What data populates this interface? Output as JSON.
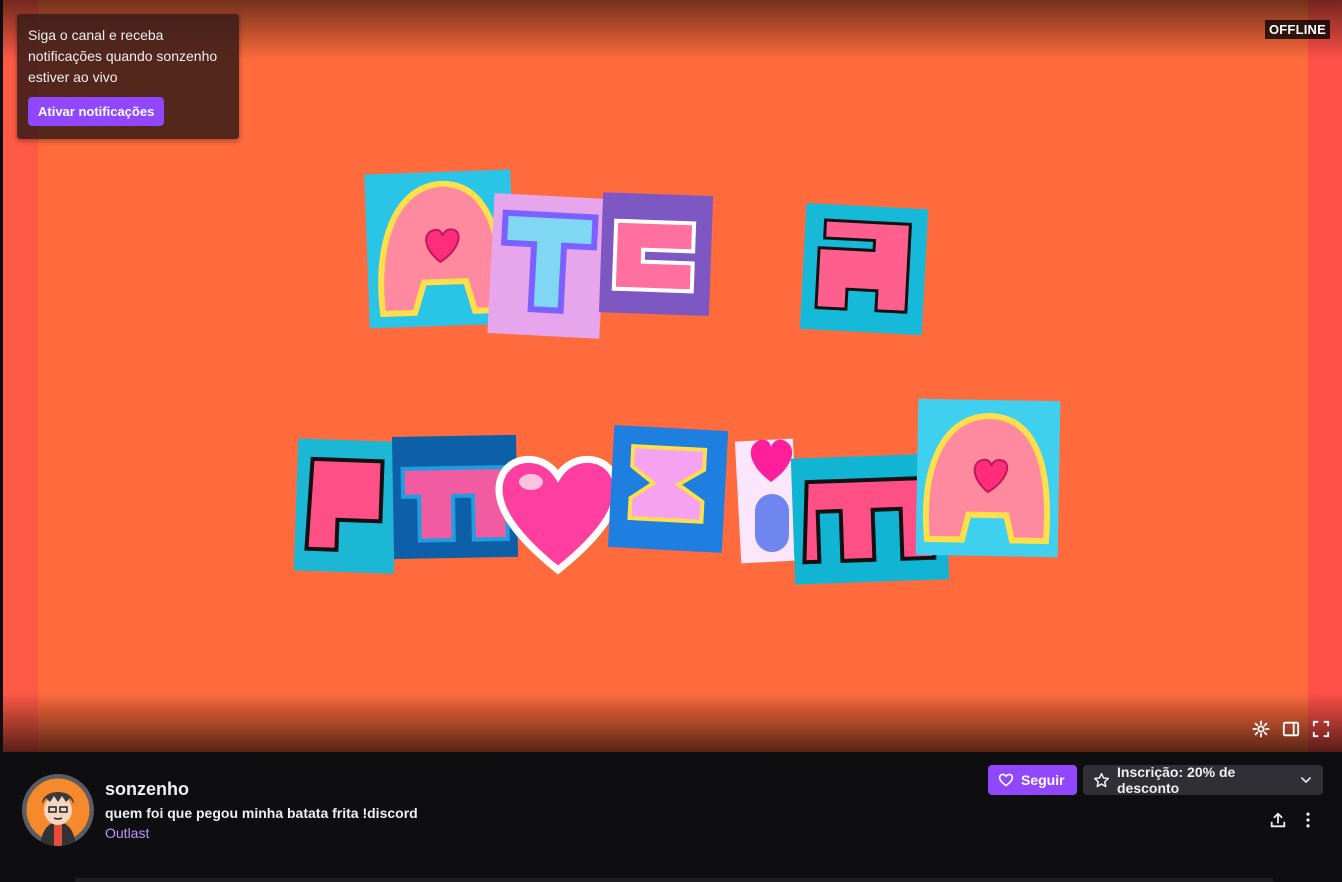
{
  "player": {
    "status_badge": "OFFLINE",
    "notification": {
      "text": "Siga o canal e receba notificações quando sonzenho estiver ao vivo",
      "button_label": "Ativar notificações"
    },
    "controls": [
      {
        "name": "settings-icon"
      },
      {
        "name": "theatre-mode-icon"
      },
      {
        "name": "fullscreen-icon"
      }
    ],
    "colors": {
      "background": "#ff6b3d",
      "accent": "#9147ff"
    }
  },
  "channel": {
    "name": "sonzenho",
    "stream_title": "quem foi que pegou minha batata frita !discord",
    "game": "Outlast"
  },
  "actions": {
    "follow_label": "Seguir",
    "subscribe_label": "Inscrição: 20% de desconto",
    "share_icon": "share-icon",
    "more_icon": "more-options-icon"
  }
}
